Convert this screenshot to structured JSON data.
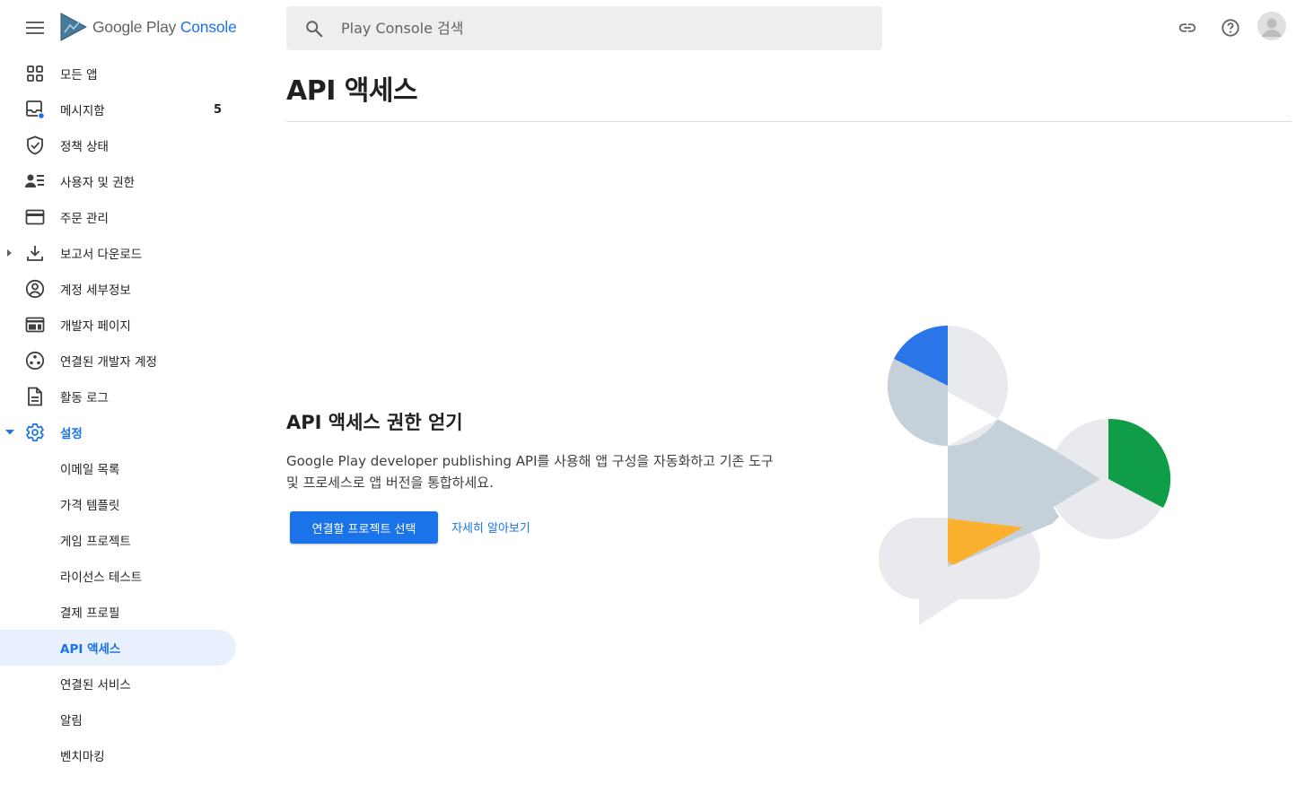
{
  "header": {
    "logo_google": "Google",
    "logo_play": "Play",
    "logo_console": "Console",
    "search_placeholder": "Play Console 검색"
  },
  "sidebar": {
    "items": [
      {
        "label": "모든 앱"
      },
      {
        "label": "메시지함",
        "badge": "5"
      },
      {
        "label": "정책 상태"
      },
      {
        "label": "사용자 및 권한"
      },
      {
        "label": "주문 관리"
      },
      {
        "label": "보고서 다운로드"
      },
      {
        "label": "계정 세부정보"
      },
      {
        "label": "개발자 페이지"
      },
      {
        "label": "연결된 개발자 계정"
      },
      {
        "label": "활동 로그"
      },
      {
        "label": "설정"
      }
    ],
    "settings_children": [
      {
        "label": "이메일 목록"
      },
      {
        "label": "가격 템플릿"
      },
      {
        "label": "게임 프로젝트"
      },
      {
        "label": "라이선스 테스트"
      },
      {
        "label": "결제 프로필"
      },
      {
        "label": "API 액세스",
        "active": true
      },
      {
        "label": "연결된 서비스"
      },
      {
        "label": "알림"
      },
      {
        "label": "벤치마킹"
      }
    ]
  },
  "main": {
    "title": "API 액세스",
    "empty_state": {
      "heading": "API 액세스 권한 얻기",
      "description": "Google Play developer publishing API를 사용해 앱 구성을 자동화하고 기존 도구 및 프로세스로 앱 버전을 통합하세요.",
      "primary_button": "연결할 프로젝트 선택",
      "link": "자세히 알아보기"
    }
  },
  "colors": {
    "accent": "#1a73e8",
    "active_bg": "#e8f0fe",
    "illus_blue": "#2a76e8",
    "illus_green": "#0f9d48",
    "illus_yellow": "#fbb02f",
    "illus_grey": "#c5d0d8",
    "illus_light": "#e8eaed"
  }
}
